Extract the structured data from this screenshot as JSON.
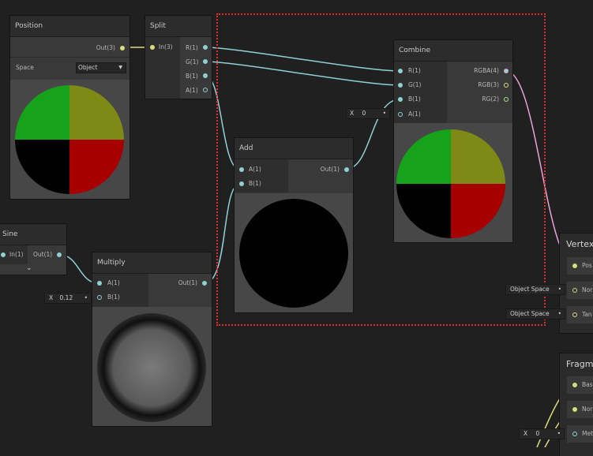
{
  "nodes": {
    "position": {
      "title": "Position",
      "out": "Out(3)",
      "space_label": "Space",
      "space_value": "Object"
    },
    "split": {
      "title": "Split",
      "in": "In(3)",
      "outs": [
        "R(1)",
        "G(1)",
        "B(1)",
        "A(1)"
      ]
    },
    "combine": {
      "title": "Combine",
      "ins": [
        "R(1)",
        "G(1)",
        "B(1)",
        "A(1)"
      ],
      "outs": [
        "RGBA(4)",
        "RGB(3)",
        "RG(2)"
      ],
      "a_x": "X",
      "a_value": "0"
    },
    "add": {
      "title": "Add",
      "ins": [
        "A(1)",
        "B(1)"
      ],
      "out": "Out(1)"
    },
    "sine": {
      "title": "Sine",
      "in": "In(1)",
      "out": "Out(1)"
    },
    "multiply": {
      "title": "Multiply",
      "ins": [
        "A(1)",
        "B(1)"
      ],
      "out": "Out(1)",
      "b_x": "X",
      "b_value": "0.12"
    },
    "vertex": {
      "title": "Vertex",
      "rows": [
        "Pos",
        "Nor",
        "Tan"
      ],
      "normal_space": "Object Space",
      "tangent_space": "Object Space"
    },
    "fragment": {
      "title": "Fragm",
      "rows": [
        "Bas",
        "Nor",
        "Met"
      ],
      "met_x": "X",
      "met_value": "0"
    }
  },
  "colors": {
    "float_wire": "#8fd0d3",
    "vec3_wire": "#d7de7a",
    "vec4_wire": "#e8a3d6",
    "vec2_wire": "#9ee27b",
    "selection": "#e32b2b"
  }
}
